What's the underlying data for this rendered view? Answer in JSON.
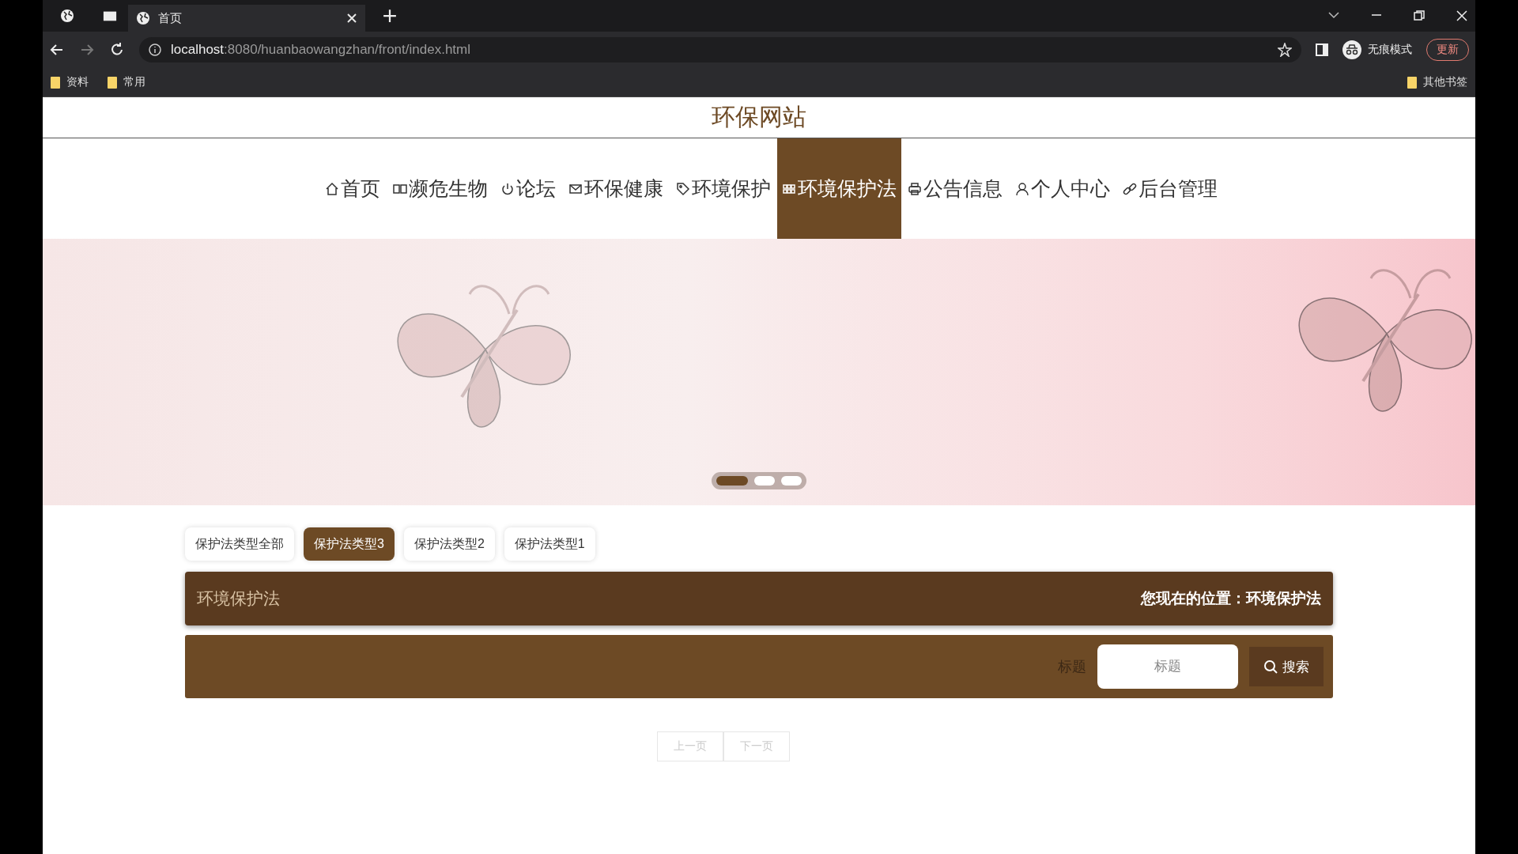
{
  "browser": {
    "tabs": [
      {
        "title": "首页",
        "selected": true
      }
    ],
    "address": {
      "host": "localhost",
      "path": ":8080/huanbaowangzhan/front/index.html"
    },
    "incognito_label": "无痕模式",
    "update_button": "更新",
    "bookmarks": [
      {
        "label": "资料"
      },
      {
        "label": "常用"
      }
    ],
    "other_bookmarks": "其他书签"
  },
  "site": {
    "title": "环保网站",
    "nav": [
      {
        "label": "首页",
        "selected": false
      },
      {
        "label": "濒危生物",
        "selected": false
      },
      {
        "label": "论坛",
        "selected": false
      },
      {
        "label": "环保健康",
        "selected": false
      },
      {
        "label": "环境保护",
        "selected": false
      },
      {
        "label": "环境保护法",
        "selected": true
      },
      {
        "label": "公告信息",
        "selected": false
      },
      {
        "label": "个人中心",
        "selected": false
      },
      {
        "label": "后台管理",
        "selected": false
      }
    ],
    "banner": {
      "dots": [
        {
          "selected": true
        },
        {
          "selected": false
        },
        {
          "selected": false
        }
      ]
    },
    "category_tabs": [
      {
        "label": "保护法类型全部",
        "selected": false
      },
      {
        "label": "保护法类型3",
        "selected": true
      },
      {
        "label": "保护法类型2",
        "selected": false
      },
      {
        "label": "保护法类型1",
        "selected": false
      }
    ],
    "header_bar": {
      "title": "环境保护法",
      "location": "您现在的位置：环境保护法"
    },
    "search": {
      "label": "标题",
      "placeholder": "标题",
      "button": "搜索"
    },
    "pagination": [
      {
        "label": "上一页",
        "disabled": true
      },
      {
        "label": "下一页",
        "disabled": true
      }
    ]
  }
}
